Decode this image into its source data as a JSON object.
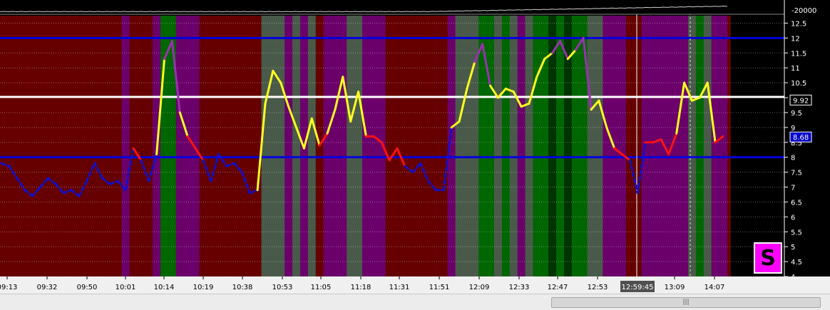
{
  "chart_data": {
    "type": "line",
    "title": "",
    "xlabel": "",
    "ylabel": "",
    "ylim": [
      4,
      12.75
    ],
    "y_ticks": [
      "12.5",
      "12",
      "11.5",
      "11",
      "10.5",
      "10",
      "9.5",
      "9",
      "8.5",
      "8",
      "7.5",
      "7",
      "6.5",
      "6",
      "5.5",
      "5",
      "4.5",
      "4"
    ],
    "x_ticks": [
      "09:13",
      "09:32",
      "09:50",
      "10:01",
      "10:14",
      "10:19",
      "10:38",
      "10:53",
      "11:05",
      "11:18",
      "11:31",
      "11:51",
      "12:09",
      "12:33",
      "12:47",
      "12:53",
      "13:09",
      "14:07"
    ],
    "top_panel_label": "-20000",
    "top_panel_flag": "F",
    "crosshair_time": "12:59:45",
    "markers": [
      {
        "label": "9.92",
        "value": 9.92
      },
      {
        "label": "8.68",
        "value": 8.68
      }
    ],
    "reference_lines": [
      12,
      8
    ],
    "white_line": 10.0,
    "series": [
      {
        "values": [
          7.8,
          7.7,
          7.3,
          6.9,
          6.7,
          7.0,
          7.3,
          7.1,
          6.8,
          6.9,
          6.7,
          7.2,
          7.8,
          7.3,
          7.1,
          7.2,
          6.9,
          8.3,
          7.9,
          7.2,
          8.1,
          11.3,
          11.9,
          9.5,
          8.7,
          8.3,
          7.9,
          7.2,
          8.1,
          7.7,
          7.8,
          7.5,
          6.8,
          6.9,
          9.8,
          10.9,
          10.5,
          9.7,
          9.0,
          8.3,
          9.3,
          8.4,
          8.8,
          9.6,
          10.7,
          9.2,
          10.2,
          8.7,
          8.7,
          8.5,
          7.9,
          8.3,
          7.7,
          7.5,
          7.8,
          7.2,
          6.9,
          6.9,
          9.0,
          9.2,
          10.3,
          11.2,
          11.8,
          10.4,
          10.0,
          10.3,
          10.2,
          9.7,
          9.8,
          10.7,
          11.3,
          11.5,
          11.9,
          11.3,
          11.6,
          12.0,
          9.6,
          9.9,
          9.0,
          8.3,
          8.1,
          7.9,
          6.8,
          8.5,
          8.5,
          8.6,
          8.1,
          8.8,
          10.5,
          9.9,
          10.0,
          10.5,
          8.5,
          8.7
        ]
      }
    ],
    "bands": [
      "pr",
      "pr",
      "pr",
      "pr",
      "pr",
      "pr",
      "pr",
      "pr",
      "pr",
      "pr",
      "pr",
      "pr",
      "pr",
      "pr",
      "pr",
      "pr",
      "pp",
      "pr",
      "pr",
      "pr",
      "pp",
      "g",
      "g",
      "pp",
      "pp",
      "pp",
      "pr",
      "pr",
      "pr",
      "pr",
      "pr",
      "pr",
      "pr",
      "pr",
      "gg",
      "gg",
      "gg",
      "pp",
      "gg",
      "pp",
      "gg",
      "pr",
      "pp",
      "pp",
      "pp",
      "gg",
      "gg",
      "pp",
      "pp",
      "pp",
      "pr",
      "pr",
      "pr",
      "pr",
      "pr",
      "pr",
      "pr",
      "pr",
      "pp",
      "gg",
      "gg",
      "gg",
      "g",
      "g",
      "gg",
      "g",
      "gg",
      "pp",
      "gg",
      "g",
      "g",
      "dg",
      "g",
      "dg",
      "g",
      "g",
      "gg",
      "gg",
      "pp",
      "pp",
      "pp",
      "pr",
      "pr",
      "pp",
      "pp",
      "pp",
      "pp",
      "pp",
      "pp",
      "gg",
      "g",
      "gg",
      "pp",
      "pp"
    ],
    "band_colors": {
      "pr": "#660000",
      "pp": "#6b006b",
      "g": "#006600",
      "gg": "#4a5a4a",
      "dg": "#003300"
    },
    "line_colors": {
      "low": "#1010cc",
      "mid": "#ff1010",
      "high": "#ffff20",
      "top": "#9b30b0"
    },
    "badge": "S",
    "scroll_grip": "|||"
  }
}
